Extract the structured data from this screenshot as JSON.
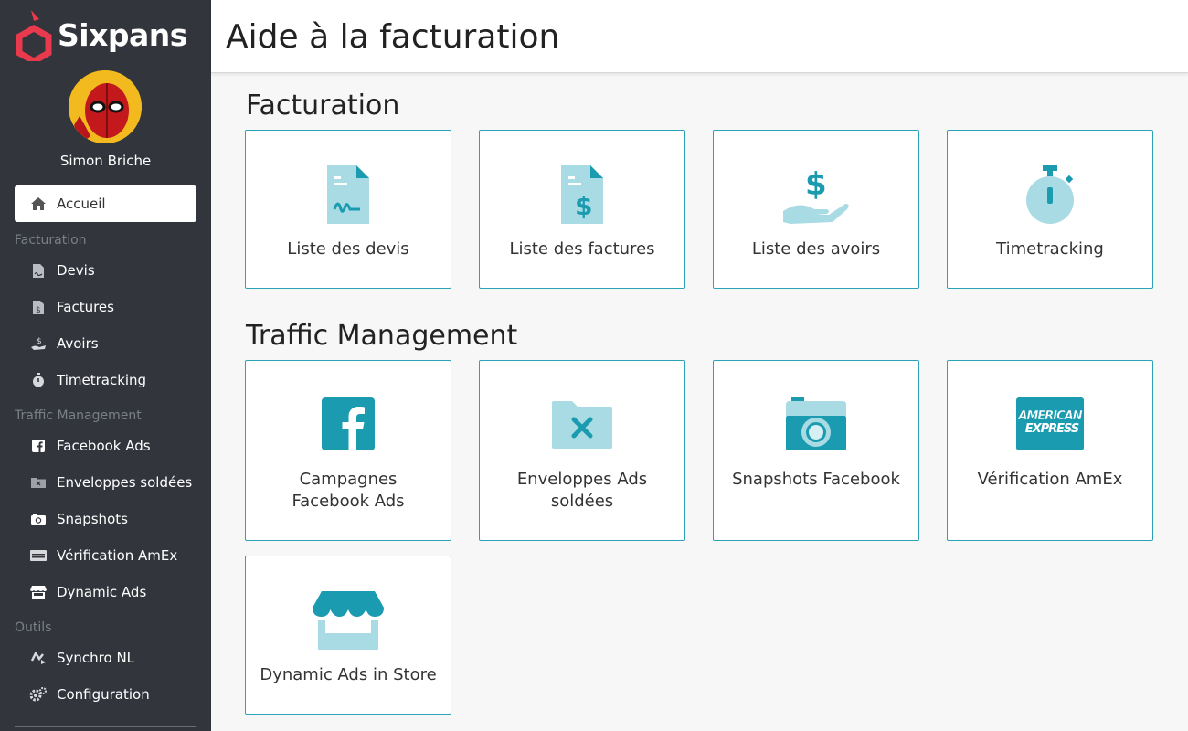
{
  "app": {
    "brand": "Sixpans"
  },
  "user": {
    "name": "Simon Briche"
  },
  "sidebar": {
    "home": {
      "label": "Accueil",
      "icon": "home-icon"
    },
    "sections": [
      {
        "title": "Facturation",
        "items": [
          {
            "label": "Devis",
            "icon": "quote-file-icon"
          },
          {
            "label": "Factures",
            "icon": "invoice-file-icon"
          },
          {
            "label": "Avoirs",
            "icon": "hand-dollar-icon"
          },
          {
            "label": "Timetracking",
            "icon": "stopwatch-icon"
          }
        ]
      },
      {
        "title": "Traffic Management",
        "items": [
          {
            "label": "Facebook Ads",
            "icon": "facebook-icon"
          },
          {
            "label": "Enveloppes soldées",
            "icon": "folder-x-icon"
          },
          {
            "label": "Snapshots",
            "icon": "camera-icon"
          },
          {
            "label": "Vérification AmEx",
            "icon": "credit-card-icon"
          },
          {
            "label": "Dynamic Ads",
            "icon": "store-icon"
          }
        ]
      },
      {
        "title": "Outils",
        "items": [
          {
            "label": "Synchro NL",
            "icon": "sync-icon"
          },
          {
            "label": "Configuration",
            "icon": "gears-icon"
          }
        ]
      }
    ]
  },
  "header": {
    "title": "Aide à la facturation"
  },
  "main": {
    "sections": [
      {
        "title": "Facturation",
        "cards": [
          {
            "label": "Liste des devis",
            "icon": "quote-file-icon"
          },
          {
            "label": "Liste des factures",
            "icon": "invoice-file-icon"
          },
          {
            "label": "Liste des avoirs",
            "icon": "hand-dollar-icon"
          },
          {
            "label": "Timetracking",
            "icon": "stopwatch-icon"
          }
        ]
      },
      {
        "title": "Traffic Management",
        "cards": [
          {
            "label_line1": "Campagnes",
            "label_line2": "Facebook Ads",
            "icon": "facebook-icon"
          },
          {
            "label_line1": "Enveloppes Ads",
            "label_line2": "soldées",
            "icon": "folder-x-icon"
          },
          {
            "label": "Snapshots Facebook",
            "icon": "camera-icon"
          },
          {
            "label": "Vérification AmEx",
            "icon": "amex-icon",
            "logo_text_1": "AMERICAN",
            "logo_text_2": "EXPRESS"
          },
          {
            "label": "Dynamic Ads in Store",
            "icon": "store-icon"
          }
        ]
      }
    ]
  },
  "colors": {
    "sidebar_bg": "#32353c",
    "accent": "#2aa3b8",
    "icon_light": "#a8dbe3",
    "icon_dark": "#1b9bb0",
    "brand_red": "#e8394d"
  }
}
